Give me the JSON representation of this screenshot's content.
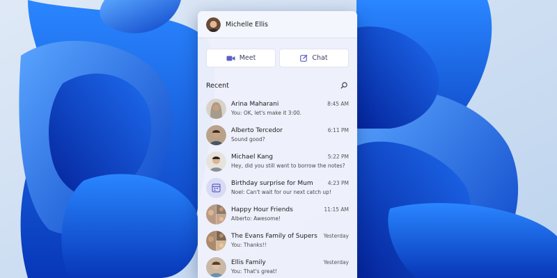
{
  "user": {
    "name": "Michelle Ellis"
  },
  "actions": [
    {
      "label": "Meet",
      "icon": "video-camera-icon"
    },
    {
      "label": "Chat",
      "icon": "compose-icon"
    }
  ],
  "recent": {
    "label": "Recent",
    "search_icon": "search-icon"
  },
  "conversations": [
    {
      "name": "Arina Maharani",
      "time": "8:45 AM",
      "preview": "You: OK, let's make it 3:00."
    },
    {
      "name": "Alberto Tercedor",
      "time": "6:11 PM",
      "preview": "Sound good?"
    },
    {
      "name": "Michael Kang",
      "time": "5:22 PM",
      "preview": "Hey, did you still want to borrow the notes?"
    },
    {
      "name": "Birthday surprise for Mum",
      "time": "4:23 PM",
      "preview": "Noel: Can't wait for our next catch up!"
    },
    {
      "name": "Happy Hour Friends",
      "time": "11:15 AM",
      "preview": "Alberto: Awesome!"
    },
    {
      "name": "The Evans Family of Supers",
      "time": "Yesterday",
      "preview": "You: Thanks!!"
    },
    {
      "name": "Ellis Family",
      "time": "Yesterday",
      "preview": "You: That's great!"
    }
  ],
  "colors": {
    "accent": "#5b5fc7",
    "wallpaper": "#0a4fd9"
  }
}
